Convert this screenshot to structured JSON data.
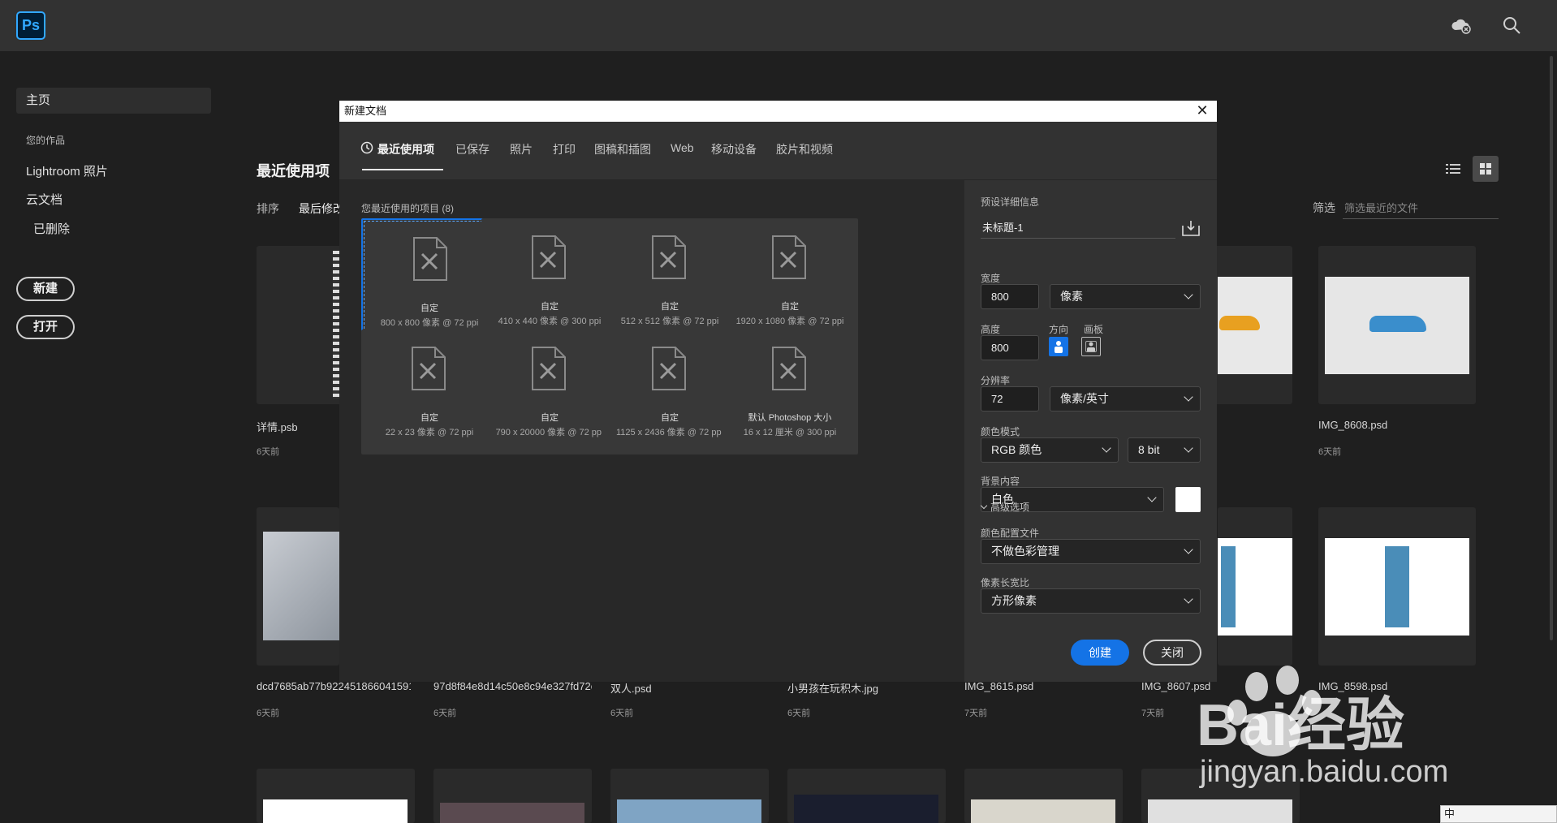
{
  "app": {
    "logo_text": "Ps"
  },
  "topbar": {
    "cloud_icon": "cloud-offline-icon",
    "search_icon": "search-icon"
  },
  "sidebar": {
    "home": "主页",
    "heading": "您的作品",
    "items": [
      {
        "label": "Lightroom 照片"
      },
      {
        "label": "云文档"
      },
      {
        "label": "已删除"
      }
    ],
    "new_button": "新建",
    "open_button": "打开"
  },
  "main": {
    "title": "最近使用项",
    "sort_label": "排序",
    "sort_value": "最后修改",
    "filter_label": "筛选",
    "filter_placeholder": "筛选最近的文件",
    "files": [
      {
        "name": "详情.psb",
        "date": "6天前"
      },
      {
        "name": "IMG_8608.psd",
        "date": "6天前"
      },
      {
        "name": "dcd7685ab77b9224518660415917a...",
        "date": "6天前"
      },
      {
        "name": "97d8f84e8d14c50e8c94e327fd72c4...",
        "date": "6天前"
      },
      {
        "name": "双人.psd",
        "date": "6天前"
      },
      {
        "name": "小男孩在玩积木.jpg",
        "date": "6天前"
      },
      {
        "name": "IMG_8615.psd",
        "date": "7天前"
      },
      {
        "name": "IMG_8607.psd",
        "date": "7天前"
      },
      {
        "name": "IMG_8598.psd",
        "date": ""
      }
    ]
  },
  "dialog": {
    "title": "新建文档",
    "close_glyph": "✕",
    "tabs": [
      {
        "label": "最近使用项"
      },
      {
        "label": "已保存"
      },
      {
        "label": "照片"
      },
      {
        "label": "打印"
      },
      {
        "label": "图稿和插图"
      },
      {
        "label": "Web"
      },
      {
        "label": "移动设备"
      },
      {
        "label": "胶片和视频"
      }
    ],
    "recent_heading": "您最近使用的项目 (8)",
    "presets": [
      {
        "name": "自定",
        "size": "800 x 800 像素 @ 72 ppi"
      },
      {
        "name": "自定",
        "size": "410 x 440 像素 @ 300 ppi"
      },
      {
        "name": "自定",
        "size": "512 x 512 像素 @ 72 ppi"
      },
      {
        "name": "自定",
        "size": "1920 x 1080 像素 @ 72 ppi"
      },
      {
        "name": "自定",
        "size": "22 x 23 像素 @ 72 ppi"
      },
      {
        "name": "自定",
        "size": "790 x 20000 像素 @ 72 ppi"
      },
      {
        "name": "自定",
        "size": "1125 x 2436 像素 @ 72 ppi"
      },
      {
        "name": "默认 Photoshop 大小",
        "size": "16 x 12 厘米 @ 300 ppi"
      }
    ],
    "details": {
      "heading": "预设详细信息",
      "doc_name": "未标题-1",
      "width_label": "宽度",
      "width_value": "800",
      "width_unit": "像素",
      "height_label": "高度",
      "height_value": "800",
      "orientation_label": "方向",
      "artboard_label": "画板",
      "resolution_label": "分辨率",
      "resolution_value": "72",
      "resolution_unit": "像素/英寸",
      "color_mode_label": "颜色模式",
      "color_mode": "RGB 颜色",
      "bit_depth": "8 bit",
      "background_label": "背景内容",
      "background": "白色",
      "background_color": "#ffffff",
      "advanced_label": "高级选项",
      "color_profile_label": "颜色配置文件",
      "color_profile": "不做色彩管理",
      "pixel_aspect_label": "像素长宽比",
      "pixel_aspect": "方形像素"
    },
    "create_button": "创建",
    "close_button": "关闭"
  },
  "watermark": {
    "brand": "Bai经验",
    "site": "jingyan.baidu.com"
  },
  "ime": {
    "text": "中"
  },
  "colors": {
    "accent": "#1473e6",
    "ps_blue": "#31a8ff",
    "dialog_bg": "#323232"
  }
}
